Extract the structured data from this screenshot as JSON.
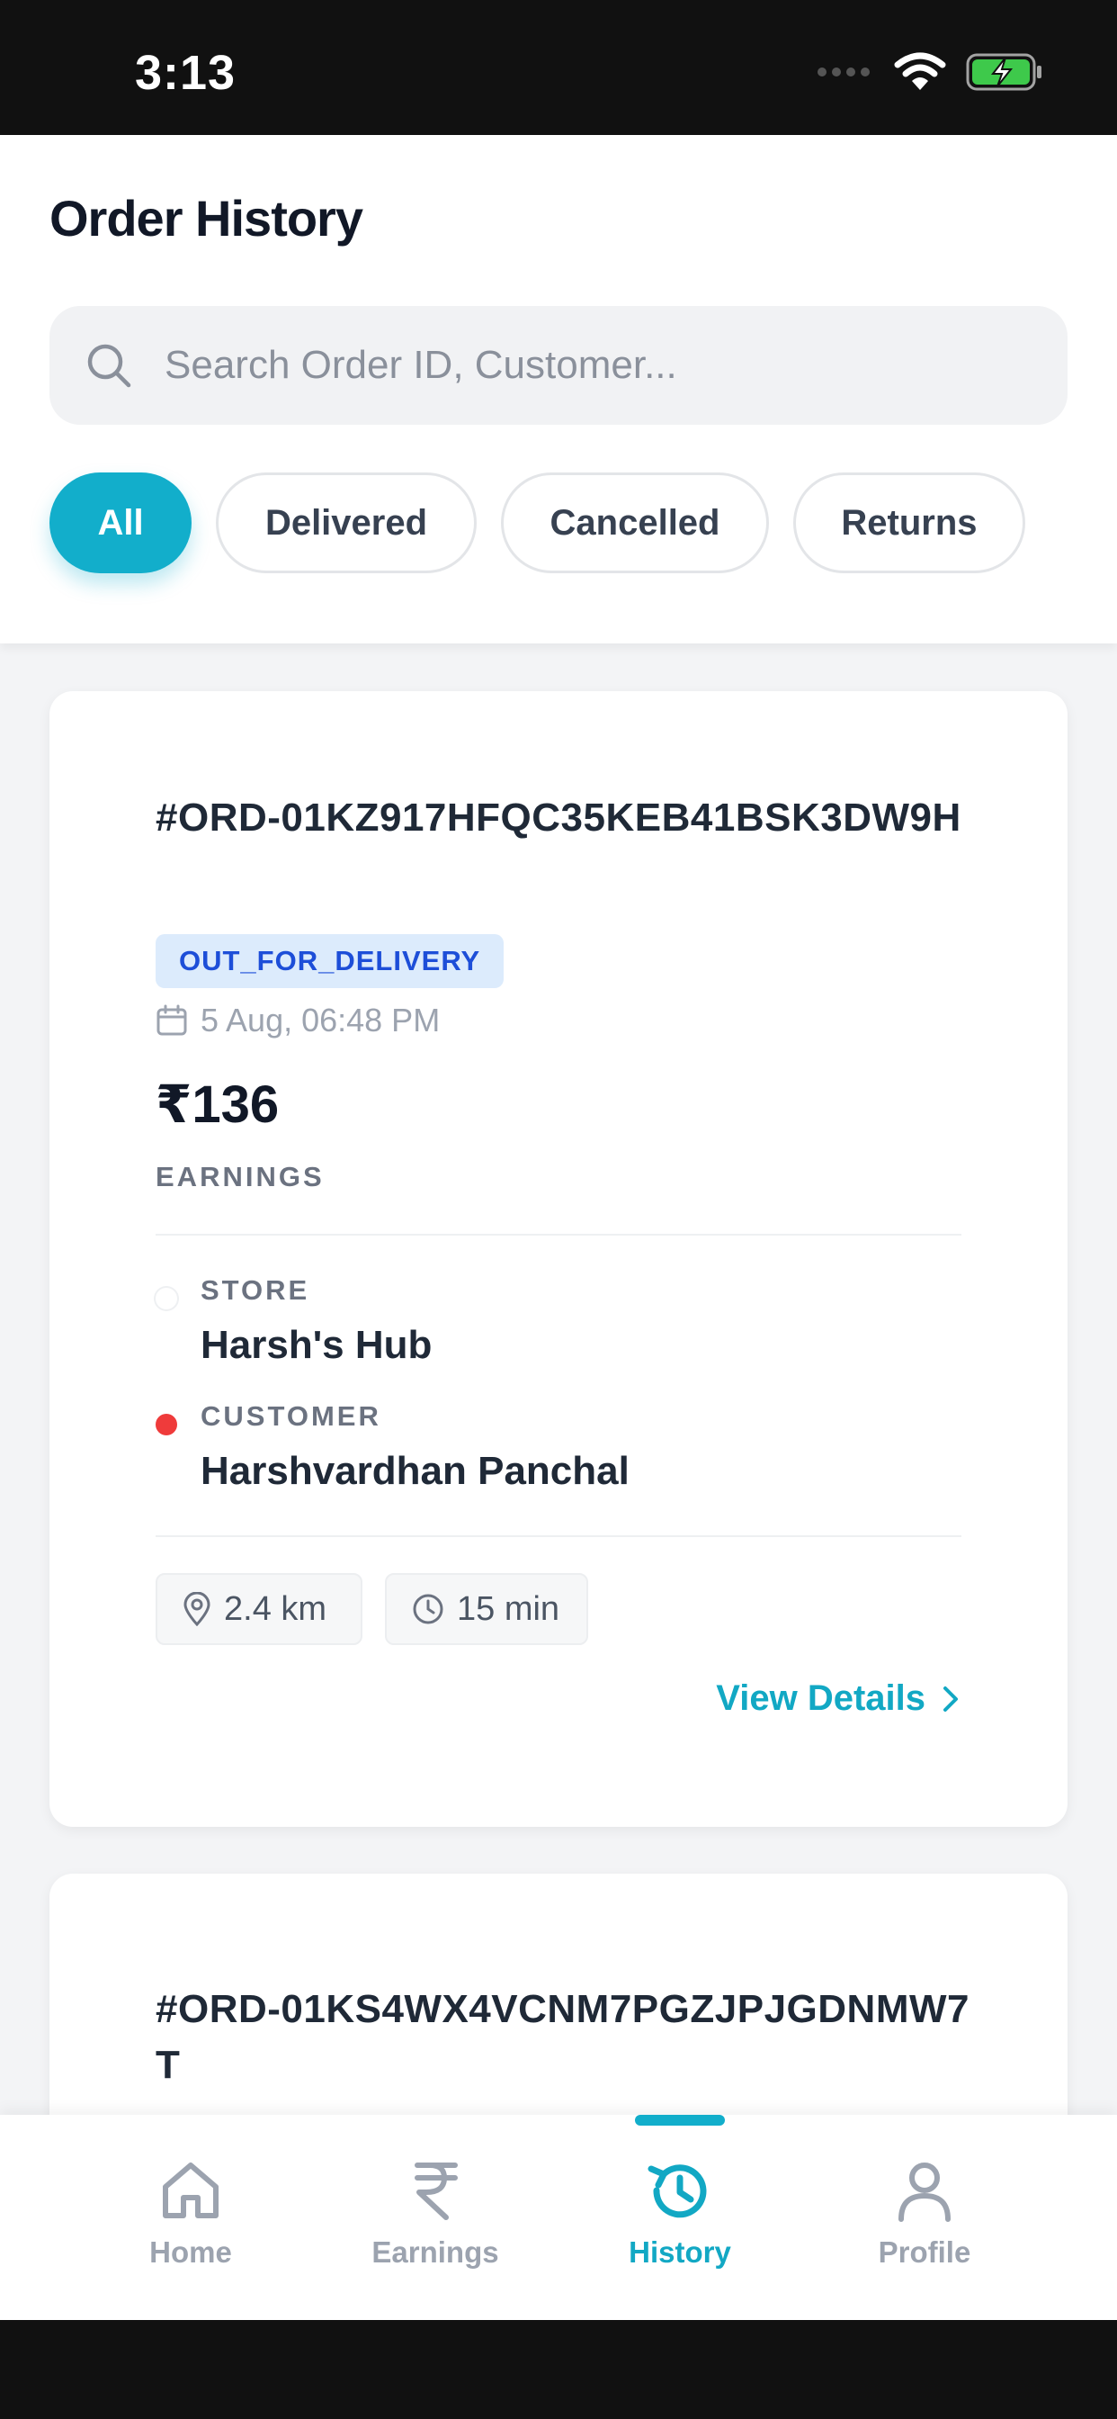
{
  "status_bar": {
    "time": "3:13"
  },
  "header": {
    "title": "Order History",
    "search": {
      "placeholder": "Search Order ID, Customer..."
    },
    "filters": [
      {
        "label": "All",
        "active": true
      },
      {
        "label": "Delivered",
        "active": false
      },
      {
        "label": "Cancelled",
        "active": false
      },
      {
        "label": "Returns",
        "active": false
      }
    ]
  },
  "orders": [
    {
      "id": "#ORD-01KZ917HFQC35KEB41BSK3DW9H",
      "status": "OUT_FOR_DELIVERY",
      "date": "5 Aug, 06:48 PM",
      "amount": "₹136",
      "amount_label": "EARNINGS",
      "store_label": "STORE",
      "store_name": "Harsh's Hub",
      "customer_label": "CUSTOMER",
      "customer_name": "Harshvardhan Panchal",
      "distance": "2.4 km",
      "duration": "15 min",
      "action_label": "View Details"
    },
    {
      "id": "#ORD-01KS4WX4VCNM7PGZJPJGDNMW7T"
    }
  ],
  "bottom_nav": [
    {
      "label": "Home",
      "icon": "home-icon",
      "active": false
    },
    {
      "label": "Earnings",
      "icon": "rupee-icon",
      "active": false
    },
    {
      "label": "History",
      "icon": "history-icon",
      "active": true
    },
    {
      "label": "Profile",
      "icon": "user-icon",
      "active": false
    }
  ],
  "colors": {
    "accent": "#12aecb",
    "badge_bg": "#dcebfc",
    "badge_text": "#1d4ed8",
    "customer_dot": "#ef3b3b"
  }
}
